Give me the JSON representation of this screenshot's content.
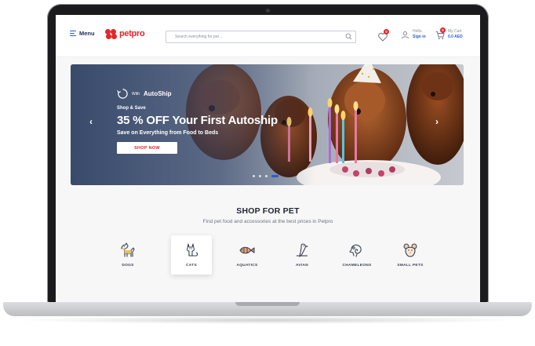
{
  "header": {
    "menu_label": "Menu",
    "logo_text": "petpro",
    "search_placeholder": "Search everything for pet...",
    "wishlist_count": "0",
    "account_greeting": "Hello,",
    "account_action": "Sign in",
    "cart_label": "My Cart",
    "cart_count": "0",
    "cart_total": "0.0 AED"
  },
  "hero": {
    "autoship_prefix": "With",
    "autoship_brand": "AutoShip",
    "subtitle": "Shop & Save",
    "title": "35 % OFF Your First Autoship",
    "description": "Save on Everything from Food to Beds",
    "cta_label": "SHOP NOW",
    "slide_count": 4,
    "active_slide": 4
  },
  "section": {
    "title": "SHOP FOR PET",
    "subtitle": "Find pet food and accessories at the best prices in Petpro",
    "categories": [
      {
        "label": "DOGS",
        "icon": "dog-icon"
      },
      {
        "label": "CATS",
        "icon": "cat-icon"
      },
      {
        "label": "AQUATICS",
        "icon": "fish-icon"
      },
      {
        "label": "AVIAN",
        "icon": "bird-icon"
      },
      {
        "label": "CHAMELEONS",
        "icon": "chameleon-icon"
      },
      {
        "label": "SMALL PETS",
        "icon": "mouse-icon"
      }
    ],
    "selected_category": "CATS"
  },
  "colors": {
    "brand_red": "#e3262b",
    "brand_blue": "#2a5bd7",
    "navy": "#1e2d5a"
  }
}
